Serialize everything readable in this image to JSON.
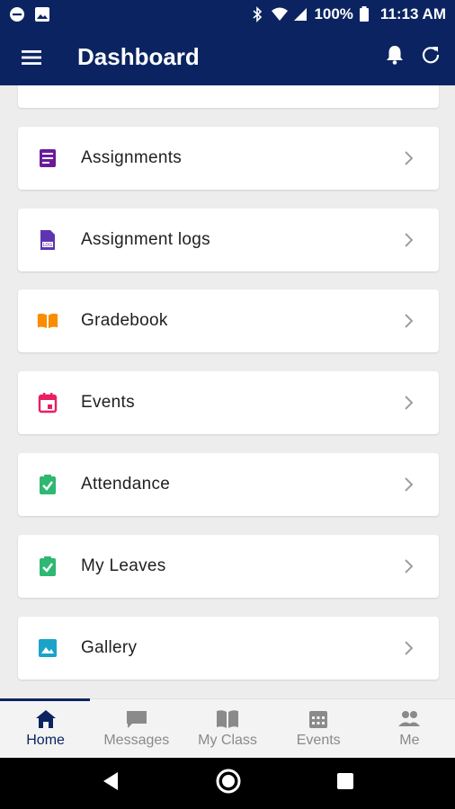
{
  "status_bar": {
    "battery": "100%",
    "time": "11:13 AM"
  },
  "app_bar": {
    "title": "Dashboard"
  },
  "menu_items": [
    {
      "label": "Assignments",
      "icon": "assignment-icon",
      "color": "#6a1b9a"
    },
    {
      "label": "Assignment logs",
      "icon": "log-file-icon",
      "color": "#5e35b1"
    },
    {
      "label": "Gradebook",
      "icon": "book-open-icon",
      "color": "#fb8c00"
    },
    {
      "label": "Events",
      "icon": "calendar-icon",
      "color": "#e91e63"
    },
    {
      "label": "Attendance",
      "icon": "clipboard-check-icon",
      "color": "#2eb872"
    },
    {
      "label": "My Leaves",
      "icon": "clipboard-check-icon",
      "color": "#2eb872"
    },
    {
      "label": "Gallery",
      "icon": "image-icon",
      "color": "#1aa3c9"
    }
  ],
  "bottom_nav": [
    {
      "label": "Home",
      "icon": "home-icon",
      "active": true
    },
    {
      "label": "Messages",
      "icon": "chat-icon",
      "active": false
    },
    {
      "label": "My Class",
      "icon": "book-icon",
      "active": false
    },
    {
      "label": "Events",
      "icon": "calendar-grid-icon",
      "active": false
    },
    {
      "label": "Me",
      "icon": "people-icon",
      "active": false
    }
  ],
  "colors": {
    "primary": "#0b2461",
    "background": "#ededed",
    "inactive": "#8a8a8a"
  }
}
